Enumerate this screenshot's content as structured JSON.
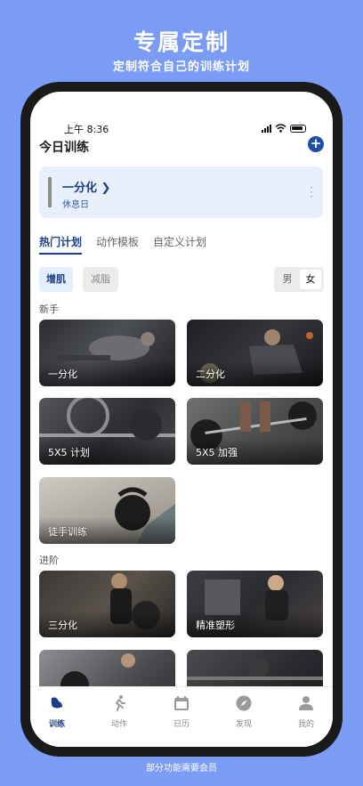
{
  "promo": {
    "title": "专属定制",
    "subtitle": "定制符合自己的训练计划",
    "footer_note": "部分功能需要会员"
  },
  "status_bar": {
    "time": "上午 8:36"
  },
  "header": {
    "title": "今日训练",
    "add_icon": "plus-circle-icon"
  },
  "current_plan": {
    "name": "一分化 ❯",
    "status": "休息日"
  },
  "tabs": [
    {
      "label": "热门计划",
      "active": true
    },
    {
      "label": "动作模板",
      "active": false
    },
    {
      "label": "自定义计划",
      "active": false
    }
  ],
  "goal_filters": [
    {
      "label": "增肌",
      "active": true
    },
    {
      "label": "减脂",
      "active": false
    }
  ],
  "gender_toggle": {
    "male": "男",
    "female": "女",
    "selected": "女"
  },
  "sections": {
    "beginner": {
      "title": "新手",
      "cards": [
        "一分化",
        "二分化",
        "5X5 计划",
        "5X5 加强",
        "徒手训练"
      ]
    },
    "advanced": {
      "title": "进阶",
      "cards": [
        "三分化",
        "精准塑形"
      ]
    }
  },
  "bottom_nav": [
    {
      "label": "训练",
      "icon": "dumbbell-icon",
      "active": true
    },
    {
      "label": "动作",
      "icon": "runner-icon",
      "active": false
    },
    {
      "label": "日历",
      "icon": "calendar-icon",
      "active": false
    },
    {
      "label": "发现",
      "icon": "compass-icon",
      "active": false
    },
    {
      "label": "我的",
      "icon": "person-icon",
      "active": false
    }
  ],
  "colors": {
    "background": "#7b9cf4",
    "accent": "#1d3f86",
    "card_bg": "#e7f0fb"
  }
}
